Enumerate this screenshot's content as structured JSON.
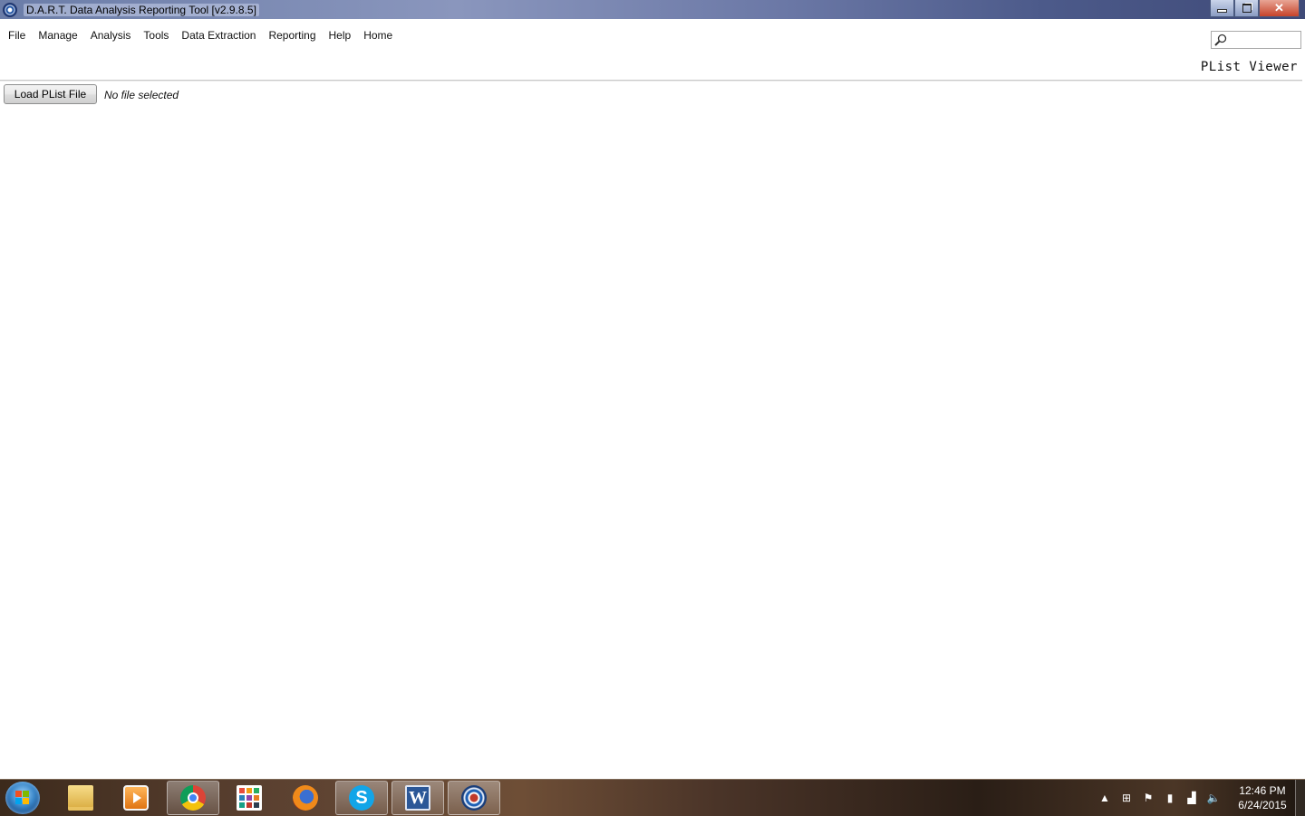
{
  "window": {
    "title": "D.A.R.T. Data Analysis Reporting Tool [v2.9.8.5]"
  },
  "menu": {
    "items": [
      {
        "id": "file",
        "label": "File"
      },
      {
        "id": "manage",
        "label": "Manage"
      },
      {
        "id": "analysis",
        "label": "Analysis"
      },
      {
        "id": "tools",
        "label": "Tools"
      },
      {
        "id": "data-extraction",
        "label": "Data Extraction"
      },
      {
        "id": "reporting",
        "label": "Reporting"
      },
      {
        "id": "help",
        "label": "Help"
      },
      {
        "id": "home",
        "label": "Home"
      }
    ]
  },
  "search": {
    "value": "",
    "icon": "magnifier-icon"
  },
  "page": {
    "heading": "PList Viewer",
    "load_button_label": "Load PList File",
    "file_status": "No file selected"
  },
  "taskbar": {
    "apps": [
      {
        "id": "explorer",
        "icon": "folder-icon"
      },
      {
        "id": "media-player",
        "icon": "media-player-icon"
      },
      {
        "id": "chrome",
        "icon": "chrome-icon"
      },
      {
        "id": "apps-grid",
        "icon": "apps-grid-icon"
      },
      {
        "id": "firefox",
        "icon": "firefox-icon"
      },
      {
        "id": "skype",
        "icon": "skype-icon"
      },
      {
        "id": "word",
        "icon": "word-icon"
      },
      {
        "id": "dart",
        "icon": "dart-icon"
      }
    ],
    "clock": {
      "time": "12:46 PM",
      "date": "6/24/2015"
    }
  }
}
